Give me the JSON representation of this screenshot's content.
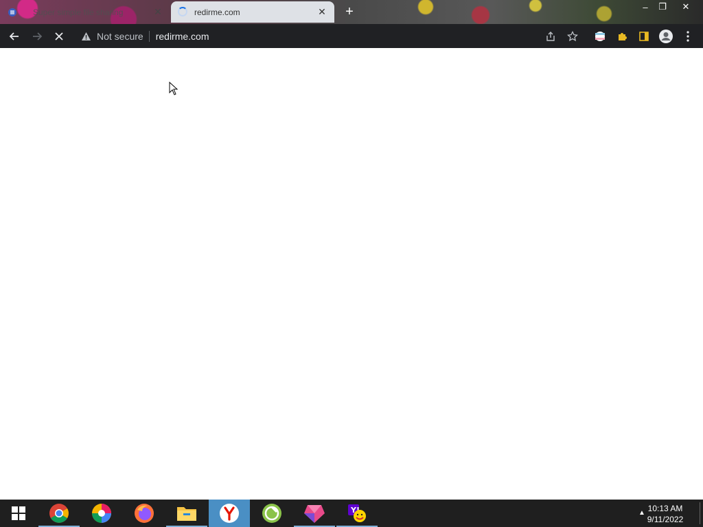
{
  "browser": {
    "tabs": [
      {
        "title": "Super simple file sharing",
        "active": false
      },
      {
        "title": "redirme.com",
        "active": true,
        "loading": true
      }
    ],
    "new_tab_label": "+",
    "window_controls": {
      "minimize": "–",
      "restore": "❐",
      "close": "✕"
    },
    "toolbar": {
      "security_label": "Not secure",
      "url": "redirme.com"
    }
  },
  "taskbar": {
    "apps": [
      {
        "name": "chrome-icon"
      },
      {
        "name": "pinwheel-app-icon"
      },
      {
        "name": "firefox-icon"
      },
      {
        "name": "file-explorer-icon"
      },
      {
        "name": "yandex-browser-icon",
        "active": true
      },
      {
        "name": "green-app-icon"
      },
      {
        "name": "pink-gem-app-icon"
      },
      {
        "name": "yahoo-messenger-icon"
      }
    ],
    "clock": {
      "time": "10:13 AM",
      "date": "9/11/2022"
    }
  },
  "colors": {
    "toolbar_bg": "#202124",
    "active_tab_bg": "#dee1e6",
    "taskbar_bg": "#1f1f1f",
    "taskbar_active": "#4a8fc4"
  }
}
